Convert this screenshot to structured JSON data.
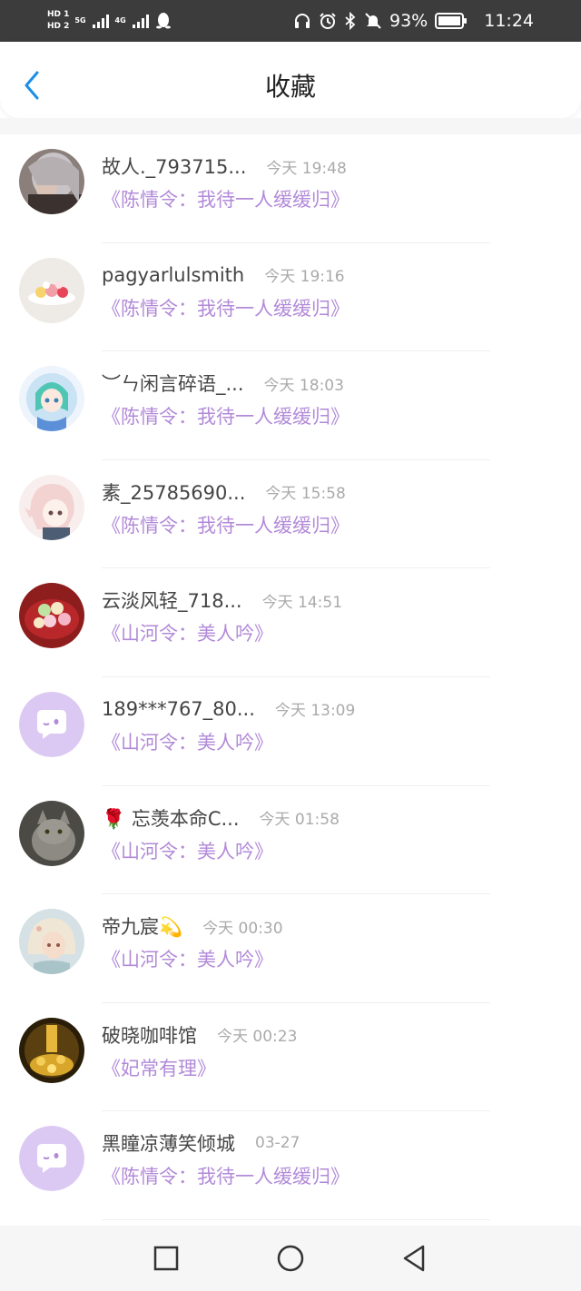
{
  "status_bar": {
    "sim1": "HD 1",
    "sim2": "HD 2",
    "net1": "5G",
    "net2": "4G",
    "battery": "93%",
    "time": "11:24"
  },
  "header": {
    "title": "收藏",
    "back_icon": "chevron-left-icon"
  },
  "colors": {
    "accent": "#1a8fe8",
    "book_title": "#b28ad8",
    "placeholder_avatar": "#dcc9f3"
  },
  "favorites": [
    {
      "name": "故人._793715...",
      "time": "今天 19:48",
      "book": "《陈情令：我待一人缓缓归》",
      "avatar": "gray-hair-photo"
    },
    {
      "name": "pagyarlulsmith",
      "time": "今天 19:16",
      "book": "《陈情令：我待一人缓缓归》",
      "avatar": "sweets-photo"
    },
    {
      "name": "︶ㄣ闲言碎语_...",
      "time": "今天 18:03",
      "book": "《陈情令：我待一人缓缓归》",
      "avatar": "anime-girl-green"
    },
    {
      "name": "素_25785690...",
      "time": "今天 15:58",
      "book": "《陈情令：我待一人缓缓归》",
      "avatar": "anime-girl-pink"
    },
    {
      "name": "云淡风轻_718...",
      "time": "今天 14:51",
      "book": "《山河令：美人吟》",
      "avatar": "dumplings-photo"
    },
    {
      "name": "189***767_80...",
      "time": "今天 13:09",
      "book": "《山河令：美人吟》",
      "avatar": "default-chat-avatar"
    },
    {
      "name": "🌹 忘羡本命C...",
      "time": "今天 01:58",
      "book": "《山河令：美人吟》",
      "avatar": "cat-photo"
    },
    {
      "name": "帝九宸💫",
      "time": "今天 00:30",
      "book": "《山河令：美人吟》",
      "avatar": "fantasy-girl"
    },
    {
      "name": "破晓咖啡馆",
      "time": "今天 00:23",
      "book": "《妃常有理》",
      "avatar": "gold-coins-photo"
    },
    {
      "name": "黑瞳凉薄笑倾城",
      "time": "03-27",
      "book": "《陈情令：我待一人缓缓归》",
      "avatar": "default-chat-avatar"
    }
  ],
  "nav": {
    "recent": "square-icon",
    "home": "circle-icon",
    "back": "triangle-back-icon"
  }
}
